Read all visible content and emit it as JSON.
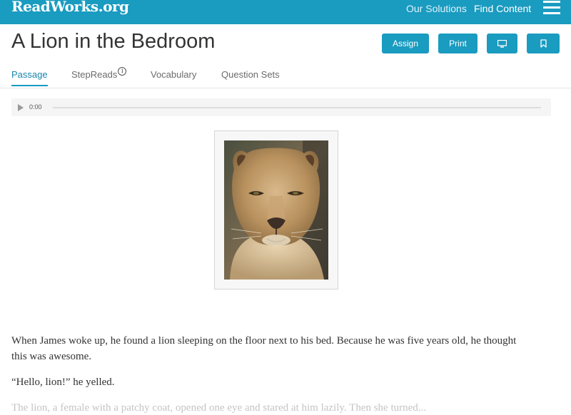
{
  "header": {
    "logo": "ReadWorks.org",
    "nav": [
      "Our Solutions",
      "Find Content"
    ],
    "menu_icon": "hamburger-menu-icon",
    "brand_color": "#1a9bc0"
  },
  "article": {
    "title": "A Lion in the Bedroom",
    "actions": {
      "assign": "Assign",
      "print": "Print",
      "present_icon": "monitor-icon",
      "bookmark_icon": "bookmark-icon"
    }
  },
  "tabs": [
    {
      "label": "Passage",
      "active": true
    },
    {
      "label": "StepReads",
      "info_icon": "i"
    },
    {
      "label": "Vocabulary"
    },
    {
      "label": "Question Sets"
    }
  ],
  "audio": {
    "time": "0:00",
    "play_icon": "play-icon",
    "progress": 0
  },
  "passage": {
    "paragraphs": [
      "When James woke up, he found a lion sleeping on the floor next to his bed. Because he was five years old, he thought this was awesome.",
      "“Hello, lion!” he yelled.",
      "The lion, a female with a patchy coat, opened one eye and stared at him lazily. Then she turned..."
    ]
  }
}
